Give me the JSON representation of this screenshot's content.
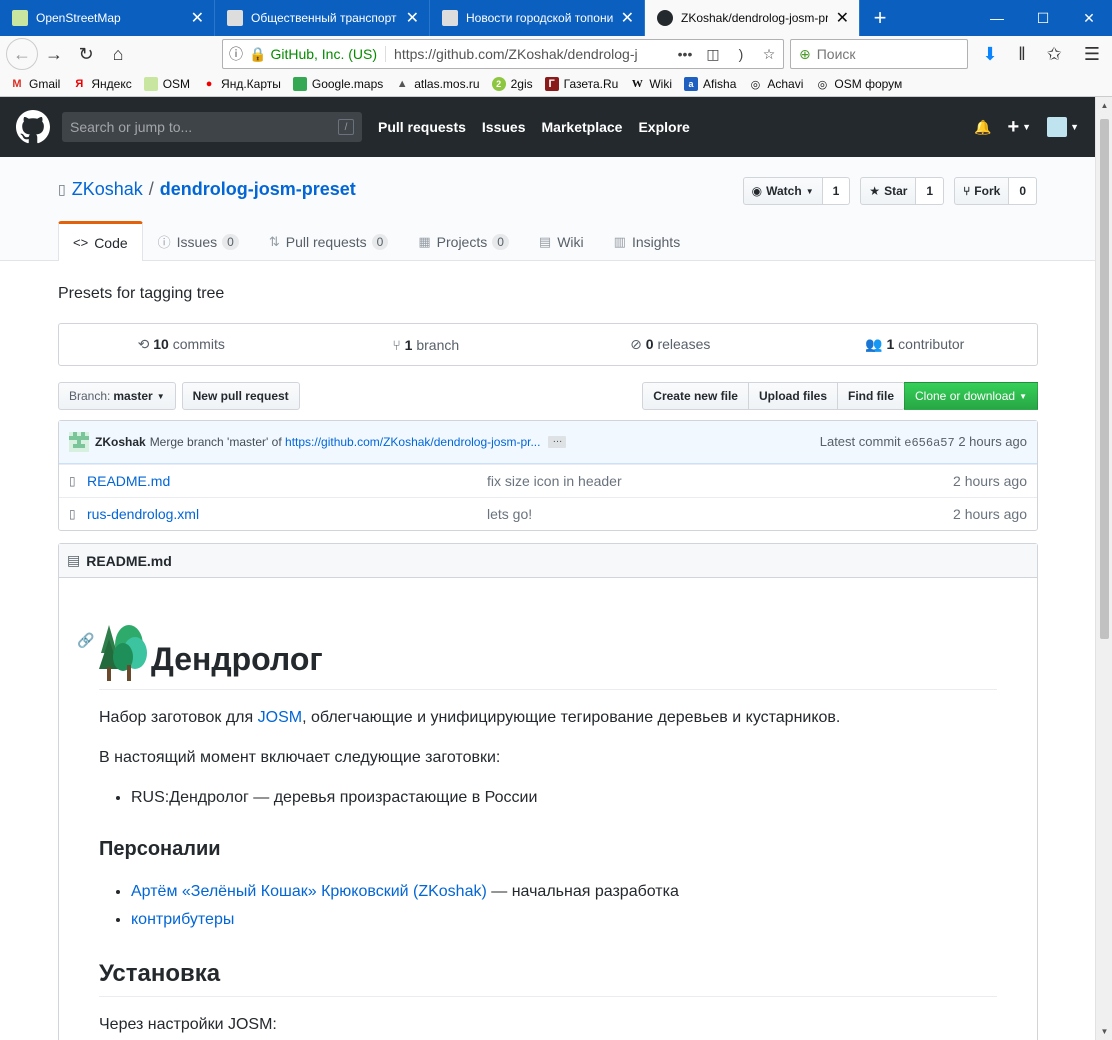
{
  "browser": {
    "tabs": [
      {
        "title": "OpenStreetMap",
        "active": false
      },
      {
        "title": "Общественный транспорт -",
        "active": false
      },
      {
        "title": "Новости городской топоним",
        "active": false
      },
      {
        "title": "ZKoshak/dendrolog-josm-pr",
        "active": true
      }
    ],
    "url_identity": "GitHub, Inc. (US)",
    "url": "https://github.com/ZKoshak/dendrolog-j",
    "search_placeholder": "Поиск",
    "bookmarks": [
      "Gmail",
      "Яндекс",
      "OSM",
      "Янд.Карты",
      "Google.maps",
      "atlas.mos.ru",
      "2gis",
      "Газета.Ru",
      "Wiki",
      "Afisha",
      "Achavi",
      "OSM форум"
    ],
    "accent": "#0a5fbf"
  },
  "github": {
    "search_placeholder": "Search or jump to...",
    "search_key": "/",
    "nav": [
      "Pull requests",
      "Issues",
      "Marketplace",
      "Explore"
    ]
  },
  "repo": {
    "owner": "ZKoshak",
    "separator": "/",
    "name": "dendrolog-josm-preset",
    "watch": {
      "label": "Watch",
      "count": "1"
    },
    "star": {
      "label": "Star",
      "count": "1"
    },
    "fork": {
      "label": "Fork",
      "count": "0"
    },
    "tabs": {
      "code": "Code",
      "issues": "Issues",
      "issues_count": "0",
      "pulls": "Pull requests",
      "pulls_count": "0",
      "projects": "Projects",
      "projects_count": "0",
      "wiki": "Wiki",
      "insights": "Insights"
    },
    "description": "Presets for tagging tree",
    "summary": {
      "commits_n": "10",
      "commits_l": "commits",
      "branch_n": "1",
      "branch_l": "branch",
      "releases_n": "0",
      "releases_l": "releases",
      "contrib_n": "1",
      "contrib_l": "contributor"
    },
    "branch_label": "Branch:",
    "branch_value": "master",
    "new_pr": "New pull request",
    "create_file": "Create new file",
    "upload_files": "Upload files",
    "find_file": "Find file",
    "clone": "Clone or download",
    "commit": {
      "author": "ZKoshak",
      "message": "Merge branch 'master' of",
      "link": "https://github.com/ZKoshak/dendrolog-josm-pr...",
      "ellipsis": "…",
      "latest_label": "Latest commit",
      "sha": "e656a57",
      "age": "2 hours ago"
    },
    "files": [
      {
        "name": "README.md",
        "message": "fix size icon in header",
        "age": "2 hours ago"
      },
      {
        "name": "rus-dendrolog.xml",
        "message": "lets go!",
        "age": "2 hours ago"
      }
    ],
    "green": "#2cbe4e"
  },
  "readme": {
    "file": "README.md",
    "h1": "Дендролог",
    "p1_before": "Набор заготовок для ",
    "p1_link": "JOSM",
    "p1_after": ", облегчающие и унифицирующие тегирование деревьев и кустарников.",
    "p2": "В настоящий момент включает следующие заготовки:",
    "li1": "RUS:Дендролог — деревья произрастающие в России",
    "h2": "Персоналии",
    "li2_link": "Артём «Зелёный Кошак» Крюковский (ZKoshak)",
    "li2_after": " — начальная разработка",
    "li3_link": "контрибутеры",
    "h2b": "Установка",
    "p3": "Через настройки JOSM:"
  }
}
